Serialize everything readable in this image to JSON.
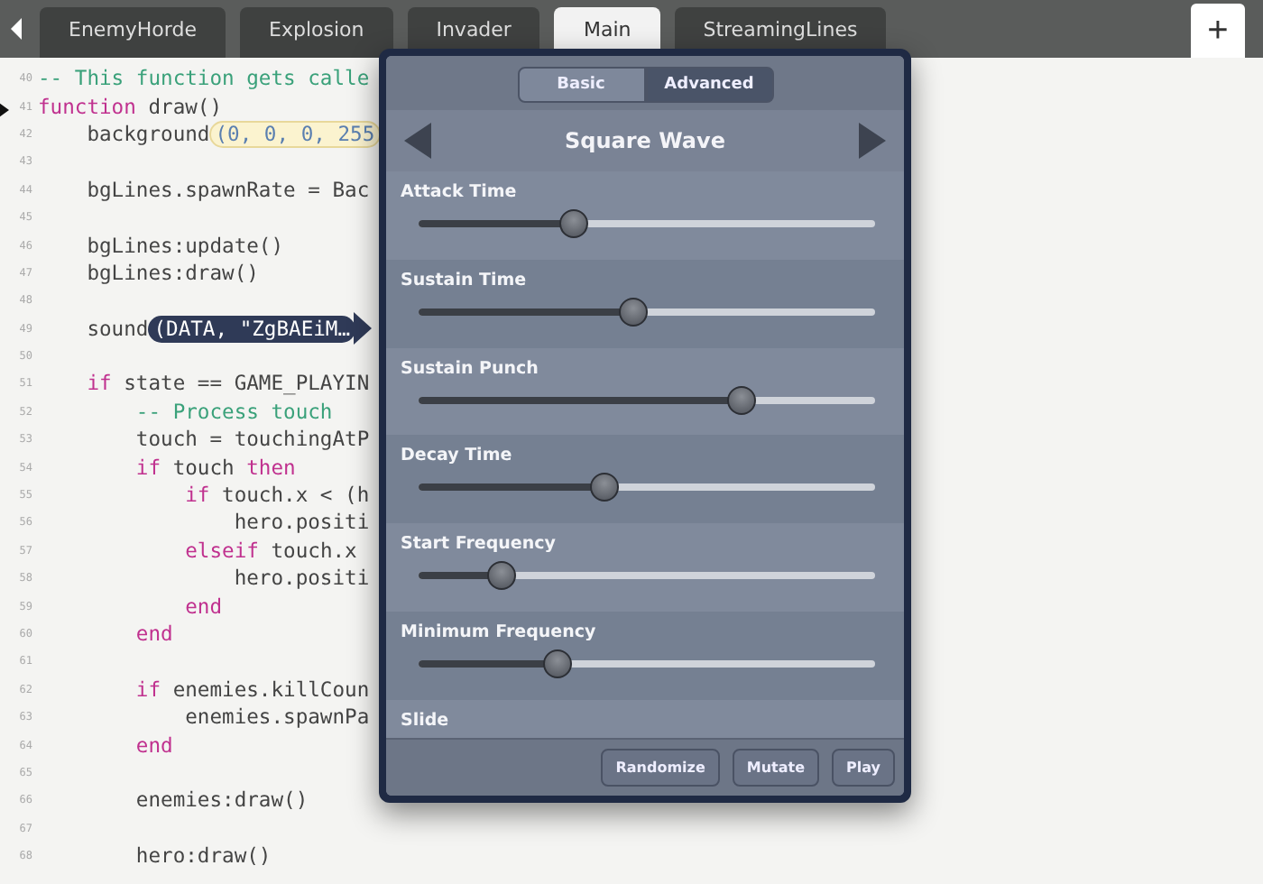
{
  "tabs": [
    {
      "label": "EnemyHorde",
      "selected": false
    },
    {
      "label": "Explosion",
      "selected": false
    },
    {
      "label": "Invader",
      "selected": false
    },
    {
      "label": "Main",
      "selected": true
    },
    {
      "label": "StreamingLines",
      "selected": false
    }
  ],
  "add_tab": "+",
  "editor": {
    "lines": [
      {
        "number": "40",
        "segments": [
          {
            "kind": "comment",
            "text": "-- This function gets calle"
          }
        ]
      },
      {
        "number": "41",
        "breakpoint": true,
        "segments": [
          {
            "kind": "keyword",
            "text": "function"
          },
          {
            "kind": "code",
            "text": " draw()"
          }
        ]
      },
      {
        "number": "42",
        "segments": [
          {
            "kind": "code",
            "text": "    background"
          },
          {
            "kind": "color",
            "text": "(0, 0, 0, 255"
          }
        ]
      },
      {
        "number": "43"
      },
      {
        "number": "44",
        "segments": [
          {
            "kind": "code",
            "text": "    bgLines.spawnRate = Bac"
          }
        ]
      },
      {
        "number": "45"
      },
      {
        "number": "46",
        "segments": [
          {
            "kind": "code",
            "text": "    bgLines:update()"
          }
        ]
      },
      {
        "number": "47",
        "segments": [
          {
            "kind": "code",
            "text": "    bgLines:draw()"
          }
        ]
      },
      {
        "number": "48"
      },
      {
        "number": "49",
        "segments": [
          {
            "kind": "code",
            "text": "    sound"
          },
          {
            "kind": "data",
            "text": "(DATA, \"ZgBAEiM…"
          }
        ]
      },
      {
        "number": "50"
      },
      {
        "number": "51",
        "segments": [
          {
            "kind": "keyword",
            "text": "    if"
          },
          {
            "kind": "code",
            "text": " state == GAME_PLAYIN"
          }
        ]
      },
      {
        "number": "52",
        "segments": [
          {
            "kind": "comment",
            "text": "        -- Process touch"
          }
        ]
      },
      {
        "number": "53",
        "segments": [
          {
            "kind": "code",
            "text": "        touch = touchingAtP"
          }
        ]
      },
      {
        "number": "54",
        "segments": [
          {
            "kind": "keyword",
            "text": "        if"
          },
          {
            "kind": "code",
            "text": " touch "
          },
          {
            "kind": "keyword",
            "text": "then"
          }
        ]
      },
      {
        "number": "55",
        "segments": [
          {
            "kind": "keyword",
            "text": "            if"
          },
          {
            "kind": "code",
            "text": " touch.x < (h"
          }
        ]
      },
      {
        "number": "56",
        "segments": [
          {
            "kind": "code",
            "text": "                hero.positi"
          }
        ]
      },
      {
        "number": "57",
        "segments": [
          {
            "kind": "keyword",
            "text": "            elseif"
          },
          {
            "kind": "code",
            "text": " touch.x"
          }
        ]
      },
      {
        "number": "58",
        "segments": [
          {
            "kind": "code",
            "text": "                hero.positi"
          }
        ]
      },
      {
        "number": "59",
        "segments": [
          {
            "kind": "keyword",
            "text": "            end"
          }
        ]
      },
      {
        "number": "60",
        "segments": [
          {
            "kind": "keyword",
            "text": "        end"
          }
        ]
      },
      {
        "number": "61"
      },
      {
        "number": "62",
        "segments": [
          {
            "kind": "keyword",
            "text": "        if"
          },
          {
            "kind": "code",
            "text": " enemies.killCoun"
          }
        ]
      },
      {
        "number": "63",
        "segments": [
          {
            "kind": "code",
            "text": "            enemies.spawnPa"
          }
        ]
      },
      {
        "number": "64",
        "segments": [
          {
            "kind": "keyword",
            "text": "        end"
          }
        ]
      },
      {
        "number": "65"
      },
      {
        "number": "66",
        "segments": [
          {
            "kind": "code",
            "text": "        enemies:draw()"
          }
        ]
      },
      {
        "number": "67"
      },
      {
        "number": "68",
        "segments": [
          {
            "kind": "code",
            "text": "        hero:draw()"
          }
        ]
      }
    ]
  },
  "sound_panel": {
    "modes": [
      {
        "label": "Basic",
        "selected": false
      },
      {
        "label": "Advanced",
        "selected": true
      }
    ],
    "waveform": "Square Wave",
    "parameters": [
      {
        "label": "Attack Time",
        "level": 0.33
      },
      {
        "label": "Sustain Time",
        "level": 0.47
      },
      {
        "label": "Sustain Punch",
        "level": 0.72
      },
      {
        "label": "Decay Time",
        "level": 0.4
      },
      {
        "label": "Start Frequency",
        "level": 0.16
      },
      {
        "label": "Minimum Frequency",
        "level": 0.29
      },
      {
        "label": "Slide"
      }
    ],
    "buttons": [
      "Randomize",
      "Mutate",
      "Play"
    ]
  }
}
